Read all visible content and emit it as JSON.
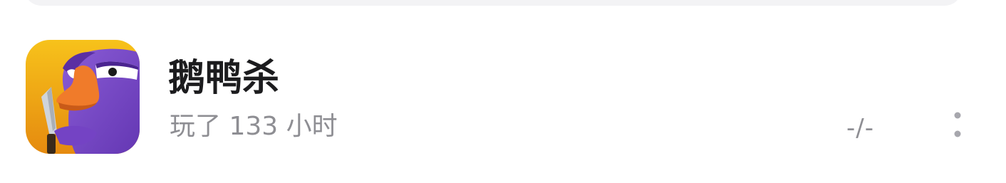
{
  "game": {
    "title": "鹅鸭杀",
    "playtime": "玩了 133 小时",
    "rating": "-/-",
    "icon": "goose-goose-duck-app-icon"
  },
  "actions": {
    "more_icon": "more-vertical-icon"
  },
  "colors": {
    "title": "#1c1c1e",
    "secondary_text": "#8e8e93",
    "icon_goose": "#7b4fc7",
    "icon_beak": "#f07b2a",
    "icon_background": "#f3a81d"
  }
}
